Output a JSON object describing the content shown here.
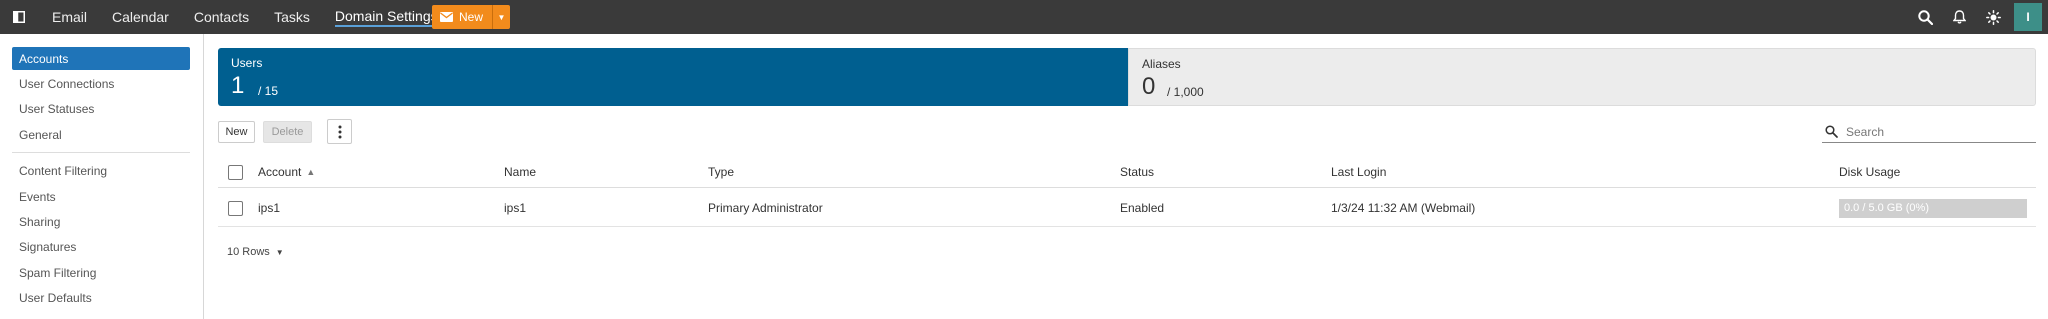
{
  "topbar": {
    "nav": [
      "Email",
      "Calendar",
      "Contacts",
      "Tasks"
    ],
    "active_nav": "Domain Settings",
    "new_label": "New",
    "avatar_letter": "I",
    "icons": [
      "sidebar-toggle-icon",
      "search-icon",
      "bell-icon",
      "sun-icon"
    ]
  },
  "sidebar": {
    "group1": [
      "Accounts",
      "User Connections",
      "User Statuses",
      "General"
    ],
    "group2": [
      "Content Filtering",
      "Events",
      "Sharing",
      "Signatures",
      "Spam Filtering",
      "User Defaults"
    ],
    "active": "Accounts"
  },
  "stats": {
    "users": {
      "label": "Users",
      "value": "1",
      "limit": "/ 15"
    },
    "aliases": {
      "label": "Aliases",
      "value": "0",
      "limit": "/ 1,000"
    }
  },
  "toolbar": {
    "new_label": "New",
    "delete_label": "Delete",
    "search_placeholder": "Search"
  },
  "table": {
    "headers": {
      "account": "Account",
      "name": "Name",
      "type": "Type",
      "status": "Status",
      "last_login": "Last Login",
      "disk_usage": "Disk Usage"
    },
    "rows": [
      {
        "account": "ips1",
        "name": "ips1",
        "type": "Primary Administrator",
        "status": "Enabled",
        "last_login": "1/3/24 11:32 AM (Webmail)",
        "disk_usage": "0.0 / 5.0 GB (0%)",
        "disk_fraction": 0
      }
    ]
  },
  "pagination": {
    "rows_label": "10 Rows"
  },
  "colors": {
    "topbar": "#3a3a3a",
    "accent": "#1f74b8",
    "users_tile": "#005f90",
    "new_button": "#f28b1c",
    "avatar": "#3d8f88"
  }
}
